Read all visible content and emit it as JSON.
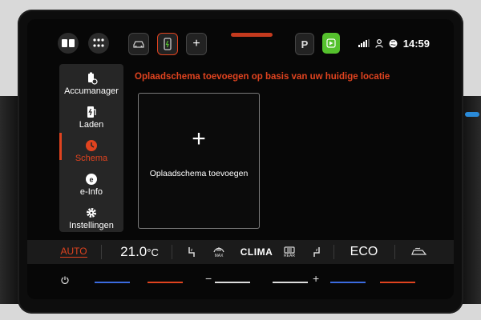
{
  "topbar": {
    "clock": "14:59",
    "park_label": "P",
    "add_label": "+",
    "colors": {
      "accent": "#e0431f",
      "carplay": "#55c12d"
    }
  },
  "sidebar": {
    "items": [
      {
        "label": "Accumanager",
        "icon": "battery-manager-icon"
      },
      {
        "label": "Laden",
        "icon": "charging-station-icon"
      },
      {
        "label": "Schema",
        "icon": "schedule-icon",
        "active": true
      },
      {
        "label": "e-Info",
        "icon": "e-info-icon"
      },
      {
        "label": "Instellingen",
        "icon": "gear-icon"
      }
    ]
  },
  "main": {
    "headline": "Oplaadschema toevoegen op basis van uw huidige locatie",
    "add_card": {
      "plus": "+",
      "caption": "Oplaadschema toevoegen"
    }
  },
  "climate": {
    "auto_label": "AUTO",
    "temperature": "21.0",
    "temperature_unit": "°C",
    "max_label": "MAX",
    "clima_label": "CLIMA",
    "rear_label": "REAR",
    "eco_label": "ECO"
  },
  "bottom": {
    "minus": "−",
    "plus": "+"
  }
}
